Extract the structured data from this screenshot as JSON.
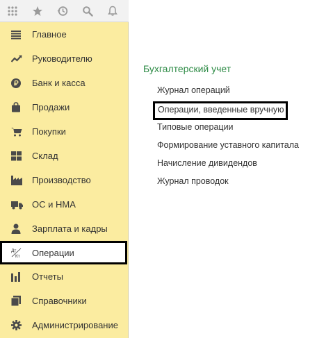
{
  "toolbar": {
    "icons": [
      "grid-icon",
      "star-icon",
      "history-icon",
      "search-icon",
      "bell-icon"
    ]
  },
  "sidebar": {
    "items": [
      {
        "label": "Главное",
        "icon": "list-icon"
      },
      {
        "label": "Руководителю",
        "icon": "trend-icon"
      },
      {
        "label": "Банк и касса",
        "icon": "ruble-icon"
      },
      {
        "label": "Продажи",
        "icon": "bag-icon"
      },
      {
        "label": "Покупки",
        "icon": "cart-icon"
      },
      {
        "label": "Склад",
        "icon": "warehouse-icon"
      },
      {
        "label": "Производство",
        "icon": "factory-icon"
      },
      {
        "label": "ОС и НМА",
        "icon": "truck-icon"
      },
      {
        "label": "Зарплата и кадры",
        "icon": "person-icon"
      },
      {
        "label": "Операции",
        "icon": "dt-kt-icon",
        "active": true
      },
      {
        "label": "Отчеты",
        "icon": "bar-chart-icon"
      },
      {
        "label": "Справочники",
        "icon": "books-icon"
      },
      {
        "label": "Администрирование",
        "icon": "gear-icon"
      }
    ],
    "dt_label": "Дт",
    "kt_label": "Кт"
  },
  "content": {
    "section_title": "Бухгалтерский учет",
    "links": [
      "Журнал операций",
      "Операции, введенные вручную",
      "Типовые операции",
      "Формирование уставного капитала",
      "Начисление дивидендов",
      "Журнал проводок"
    ]
  },
  "colors": {
    "sidebar_bg": "#fbeca0",
    "section_title": "#2e8b46",
    "icon": "#4a4a4a"
  }
}
